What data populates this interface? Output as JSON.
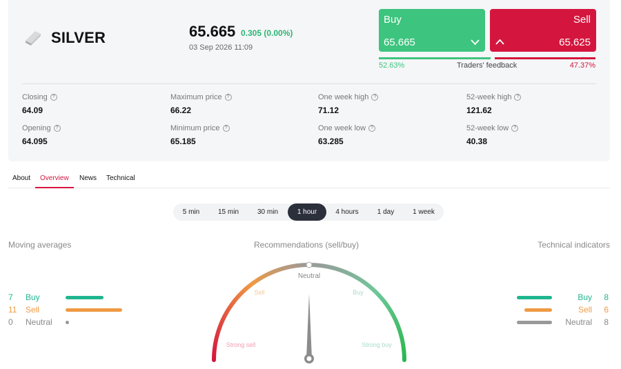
{
  "asset": {
    "name": "SILVER",
    "icon": "silver-bar-icon"
  },
  "quote": {
    "price": "65.665",
    "change": "0.305 (0.00%)",
    "datetime": "03 Sep 2026 11:09"
  },
  "trade": {
    "buy": {
      "label": "Buy",
      "value": "65.665",
      "icon": "chevron-down-icon"
    },
    "sell": {
      "label": "Sell",
      "value": "65.625",
      "icon": "chevron-up-icon"
    }
  },
  "feedback": {
    "buy_pct": "52.63%",
    "label": "Traders' feedback",
    "sell_pct": "47.37%",
    "buy_fraction": 0.5263
  },
  "stats": [
    {
      "label": "Closing",
      "value": "64.09"
    },
    {
      "label": "Maximum price",
      "value": "66.22"
    },
    {
      "label": "One week high",
      "value": "71.12"
    },
    {
      "label": "52-week high",
      "value": "121.62"
    },
    {
      "label": "Opening",
      "value": "64.095"
    },
    {
      "label": "Minimum price",
      "value": "65.185"
    },
    {
      "label": "One week low",
      "value": "63.285"
    },
    {
      "label": "52-week low",
      "value": "40.38"
    }
  ],
  "tabs": [
    {
      "label": "About",
      "active": false
    },
    {
      "label": "Overview",
      "active": true
    },
    {
      "label": "News",
      "active": false
    },
    {
      "label": "Technical",
      "active": false
    }
  ],
  "periods": [
    {
      "label": "5 min",
      "active": false
    },
    {
      "label": "15 min",
      "active": false
    },
    {
      "label": "30 min",
      "active": false
    },
    {
      "label": "1 hour",
      "active": true
    },
    {
      "label": "4 hours",
      "active": false
    },
    {
      "label": "1 day",
      "active": false
    },
    {
      "label": "1 week",
      "active": false
    }
  ],
  "moving_averages": {
    "title": "Moving averages",
    "rows": [
      {
        "count": "7",
        "label": "Buy",
        "color": "#1fb58f"
      },
      {
        "count": "11",
        "label": "Sell",
        "color": "#ef9a43"
      },
      {
        "count": "0",
        "label": "Neutral",
        "color": "#999999"
      }
    ]
  },
  "recommendations": {
    "title": "Recommendations (sell/buy)",
    "labels": {
      "neutral": "Neutral",
      "sell": "Sell",
      "buy": "Buy",
      "strong_sell": "Strong sell",
      "strong_buy": "Strong buy"
    },
    "needle_position": 0.5
  },
  "technical_indicators": {
    "title": "Technical indicators",
    "rows": [
      {
        "label": "Buy",
        "count": "8",
        "color": "#1fb58f"
      },
      {
        "label": "Sell",
        "count": "6",
        "color": "#ef9a43"
      },
      {
        "label": "Neutral",
        "count": "8",
        "color": "#999999"
      }
    ]
  },
  "colors": {
    "buy": "#3dc47e",
    "sell": "#d4163e",
    "active_tab": "#d4163e",
    "active_period": "#2b303b"
  }
}
